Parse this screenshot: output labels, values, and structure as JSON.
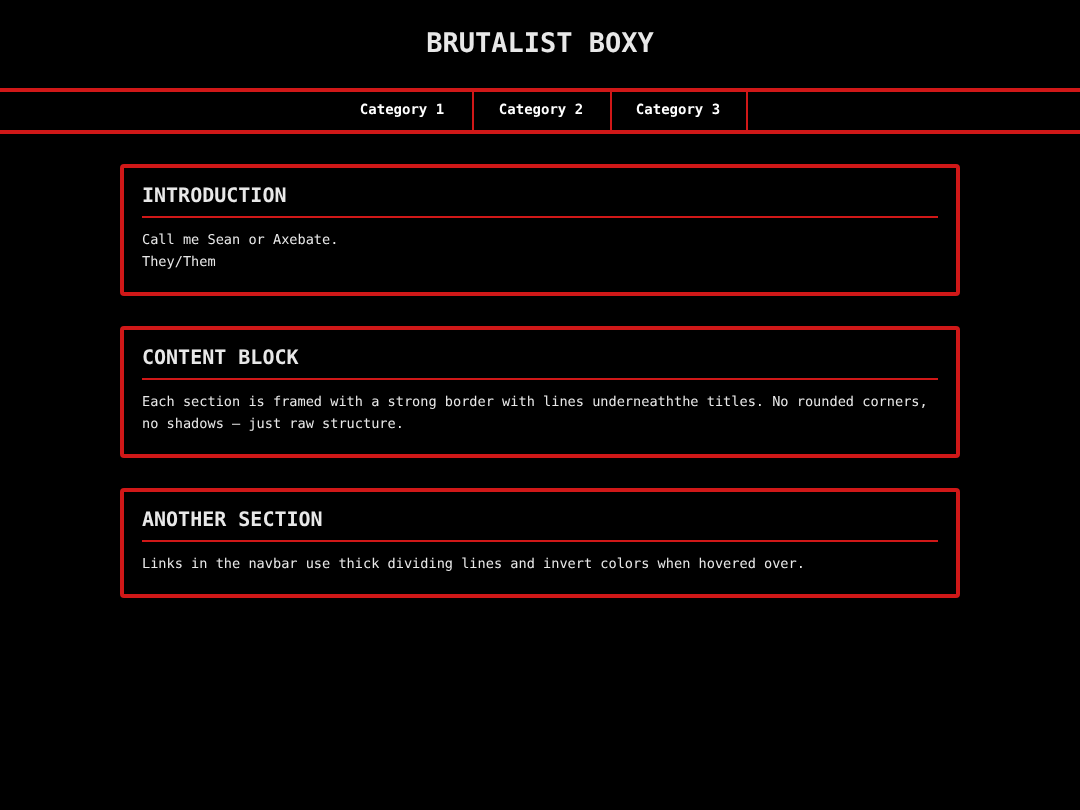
{
  "header": {
    "title": "BRUTALIST BOXY"
  },
  "nav": [
    {
      "label": "Category 1"
    },
    {
      "label": "Category 2"
    },
    {
      "label": "Category 3"
    }
  ],
  "sections": [
    {
      "title": "INTRODUCTION",
      "lines": [
        "Call me Sean or Axebate.",
        "They/Them"
      ]
    },
    {
      "title": "CONTENT BLOCK",
      "lines": [
        "Each section is framed with a strong border with lines underneaththe titles. No rounded corners, no shadows — just raw structure."
      ]
    },
    {
      "title": "ANOTHER SECTION",
      "lines": [
        "Links in the navbar use thick dividing lines and invert colors when hovered over."
      ]
    }
  ]
}
